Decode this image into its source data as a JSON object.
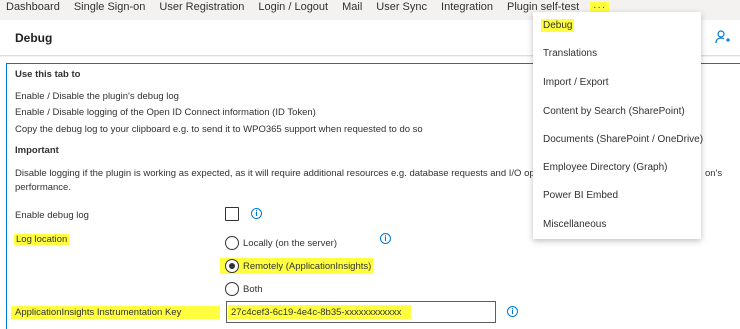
{
  "topnav": {
    "items": [
      "Dashboard",
      "Single Sign-on",
      "User Registration",
      "Login / Logout",
      "Mail",
      "User Sync",
      "Integration",
      "Plugin self-test"
    ],
    "more_label": "···"
  },
  "header": {
    "title": "Debug",
    "icon": "person-settings-icon"
  },
  "content": {
    "use_tab_heading": "Use this tab to",
    "use_lines": [
      "Enable / Disable the plugin's debug log",
      "Enable / Disable logging of the Open ID Connect information (ID Token)",
      "Copy the debug log to your clipboard e.g. to send it to WPO365 support when requested to do so"
    ],
    "important_heading": "Important",
    "important_text_1": "Disable logging if the plugin is working as expected, as it will require additional resources e.g. database requests and I/O operations an",
    "important_text_tail": "on's",
    "important_text_2": "performance.",
    "enable_debug_label": "Enable debug log",
    "enable_debug_checked": false,
    "log_location_label": "Log location",
    "log_options": [
      {
        "label": "Locally (on the server)",
        "checked": false
      },
      {
        "label": "Remotely (ApplicationInsights)",
        "checked": true
      },
      {
        "label": "Both",
        "checked": false
      }
    ],
    "instr_key_label": "ApplicationInsights Instrumentation Key",
    "instr_key_value": "27c4cef3-6c19-4e4c-8b35-xxxxxxxxxxxx"
  },
  "dropdown": {
    "items": [
      "Debug",
      "Translations",
      "Import / Export",
      "Content by Search (SharePoint)",
      "Documents (SharePoint / OneDrive)",
      "Employee Directory (Graph)",
      "Power BI Embed",
      "Miscellaneous"
    ],
    "selected": "Debug"
  },
  "colors": {
    "highlight": "#ffff3f",
    "accent": "#0078d4"
  }
}
